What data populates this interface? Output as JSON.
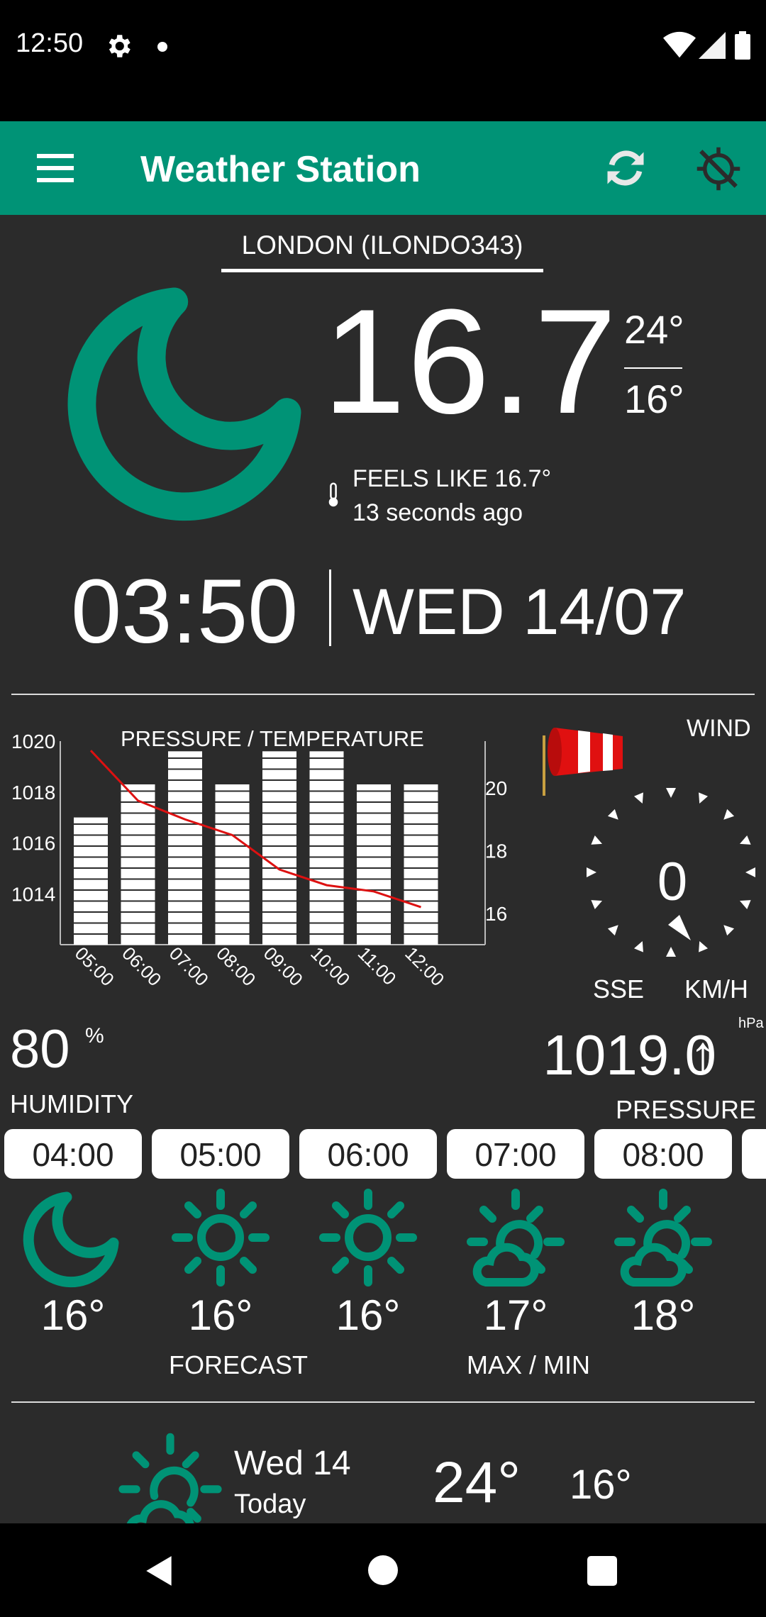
{
  "status_bar": {
    "time": "12:50"
  },
  "app_bar": {
    "title": "Weather Station"
  },
  "location": {
    "label": "LONDON (ILONDO343)"
  },
  "current": {
    "temperature": "16.7",
    "max": "24°",
    "min": "16°",
    "feels_like": "FEELS LIKE 16.7°",
    "updated": "13 seconds ago"
  },
  "clock": {
    "time": "03:50",
    "date": "WED 14/07"
  },
  "chart_data": {
    "type": "bar",
    "title": "PRESSURE / TEMPERATURE",
    "categories": [
      "05:00",
      "06:00",
      "07:00",
      "08:00",
      "09:00",
      "10:00",
      "11:00",
      "12:00"
    ],
    "series": [
      {
        "values": [
          1017,
          1018.3,
          1019.6,
          1018.3,
          1019.6,
          1019.6,
          1018.3,
          1018.3
        ]
      },
      {
        "values": [
          21.2,
          19.6,
          19,
          18.5,
          17.4,
          16.9,
          16.7,
          16.2
        ]
      }
    ],
    "left_ticks": [
      "1020",
      "1018",
      "1016",
      "1014"
    ],
    "right_ticks": [
      "20",
      "18",
      "16"
    ],
    "ylim_left": [
      1012,
      1020
    ],
    "ylim_right": [
      15,
      21.5
    ],
    "colors": {
      "bars": "#ffffff",
      "line": "#dd1111",
      "axis": "#bbbbbb"
    }
  },
  "wind": {
    "label": "WIND",
    "speed": "0",
    "direction": "SSE",
    "unit": "KM/H"
  },
  "humidity": {
    "value": "80",
    "unit": "%",
    "label": "HUMIDITY"
  },
  "pressure": {
    "value": "1019.0",
    "trend_arrow": "↑",
    "unit": "hPa",
    "label": "PRESSURE"
  },
  "hourly": [
    {
      "time": "04:00",
      "temp": "16°",
      "icon": "moon-icon"
    },
    {
      "time": "05:00",
      "temp": "16°",
      "icon": "sun-icon"
    },
    {
      "time": "06:00",
      "temp": "16°",
      "icon": "sun-icon"
    },
    {
      "time": "07:00",
      "temp": "17°",
      "icon": "partly-cloudy-icon"
    },
    {
      "time": "08:00",
      "temp": "18°",
      "icon": "partly-cloudy-icon"
    }
  ],
  "footer": {
    "forecast_label": "FORECAST",
    "maxmin_label": "MAX / MIN"
  },
  "daily": [
    {
      "day": "Wed 14",
      "sub": "Today",
      "max": "24°",
      "min": "16°",
      "icon": "partly-cloudy-icon"
    }
  ],
  "colors": {
    "accent": "#009376",
    "background": "#2b2b2b",
    "status_bar": "#000000"
  }
}
